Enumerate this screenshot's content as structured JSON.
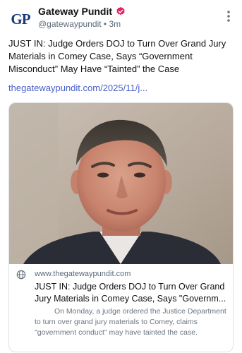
{
  "post": {
    "author_initials": "GP",
    "author_name": "Gateway Pundit",
    "handle": "@gatewaypundit",
    "separator": "•",
    "time": "3m",
    "text": "JUST IN: Judge Orders DOJ to Turn Over Grand Jury Materials in Comey Case, Says “Government Misconduct” May Have “Tainted” the Case",
    "link": "thegatewaypundit.com/2025/11/j..."
  },
  "card": {
    "domain": "www.thegatewaypundit.com",
    "title": "JUST IN: Judge Orders DOJ to Turn Over Grand Jury Materials in Comey Case, Says \"Governm...",
    "description": "On Monday, a judge ordered the Justice Department to turn over grand jury materials to Comey, claims \"government conduct\" may have tainted the case."
  },
  "colors": {
    "link": "#4a5fc7",
    "verified_badge": "#e0245e",
    "avatar_text": "#1b3a7a"
  },
  "icons": [
    "verified-badge-icon",
    "more-options-icon",
    "globe-icon"
  ]
}
